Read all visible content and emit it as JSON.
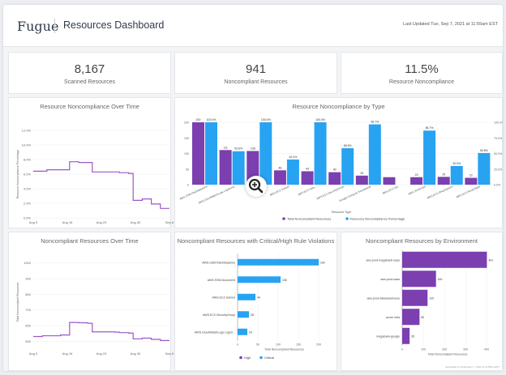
{
  "header": {
    "logo": "Fugue",
    "title": "Resources Dashboard",
    "updated": "Last Updated Tue, Sep 7, 2021 at 11:55am EST"
  },
  "stats": [
    {
      "value": "8,167",
      "label": "Scanned Resources"
    },
    {
      "value": "941",
      "label": "Noncompliant Resources"
    },
    {
      "value": "11.5%",
      "label": "Resource Noncompliance"
    }
  ],
  "colors": {
    "purple": "#7b3fb0",
    "blue": "#27a3f2",
    "line": "#9b59c8"
  },
  "footer": "Generated on September 7, 2021 at 11:55am EST",
  "chart_data": [
    {
      "type": "line",
      "title": "Resource Noncompliance Over Time",
      "ylabel": "Resource Noncompliance Percentage",
      "x_ticks": [
        "Aug 9",
        "Aug 16",
        "Aug 23",
        "Aug 30",
        "Sep 6"
      ],
      "y_ticks": [
        "0.0%",
        "2.0%",
        "4.0%",
        "6.0%",
        "8.0%",
        "10.0%",
        "12.0%"
      ],
      "ylim": [
        0,
        12
      ],
      "x": [
        0,
        1,
        2,
        3,
        4,
        5,
        6,
        7,
        8,
        9,
        10,
        11,
        12,
        13,
        14,
        15,
        16,
        17,
        18,
        19,
        20,
        21,
        22,
        23,
        24,
        25,
        26,
        27,
        28,
        29,
        30
      ],
      "values": [
        6.4,
        6.4,
        6.4,
        6.6,
        6.6,
        6.6,
        6.6,
        6.6,
        7.7,
        7.7,
        7.6,
        7.6,
        7.6,
        6.3,
        6.3,
        6.3,
        6.3,
        6.3,
        6.3,
        6.2,
        6.2,
        6.1,
        2.4,
        2.4,
        2.6,
        2.6,
        1.9,
        1.9,
        1.3,
        1.3,
        1.3
      ]
    },
    {
      "type": "bar",
      "title": "Resource Noncompliance by Type",
      "xlabel": "Resource Type",
      "categories": [
        "AWS.IAM.PatchBaseline",
        "AWS.CloudWatchLogs.LogGroup",
        "AWS.Lambda",
        "AWS.EC2.Subnet",
        "AWS.EC2.Volume",
        "AWS.EC2.SecurityGroup",
        "Google.Compute.Subnetwork",
        "AWS.EC2.Vpc",
        "AWS.S3.Bucket",
        "AWS.EC2.DhcpOptions",
        "AWS.EC2.RouteTable"
      ],
      "x_tick_labels": [
        "AWS.SSM.PatchBaseline",
        "AWS.CloudWatchLogs.LogGroup",
        "AWS",
        "AWS.EC2.Subnet",
        "AWS.EC2.Volu...",
        "AWS.EC2.SecurityGroup",
        "Google.Compute.Subnetwork",
        "AWS.EC2.Vpc",
        "AWS.S3.Bucket",
        "AWS.EC2.DhcpOptions",
        "AWS.EC2.RouteTable"
      ],
      "series": [
        {
          "name": "Total Noncompliant Resources",
          "values": [
            200,
            111,
            108,
            46,
            43,
            40,
            29,
            24,
            24,
            25,
            22
          ],
          "labels": [
            "200",
            "111",
            "108",
            "46",
            "43",
            "40",
            "29",
            "",
            "24",
            "25",
            "22"
          ]
        },
        {
          "name": "Resource Noncompliance Percentage",
          "values": [
            100,
            53.6,
            100,
            40.4,
            100,
            58.5,
            96.7,
            0,
            86.7,
            30,
            50.8
          ],
          "labels": [
            "100.0%",
            "53.6%",
            "",
            "40.4%",
            "100.0%",
            "58.5%",
            "96.7%",
            "",
            "86.7%",
            "30.0%",
            "50.8%"
          ]
        }
      ],
      "extra_labels": [
        "100.0%"
      ],
      "y_ticks": [
        "0",
        "50",
        "100",
        "150",
        "200"
      ],
      "y2_ticks": [
        "0.0%",
        "25.0%",
        "50.0%",
        "75.0%",
        "100.0%"
      ],
      "ylim": [
        0,
        200
      ]
    },
    {
      "type": "line",
      "title": "Noncompliant Resources Over Time",
      "ylabel": "Total Noncompliant Resources",
      "x_ticks": [
        "Aug 9",
        "Aug 16",
        "Aug 23",
        "Aug 30",
        "Sep 6"
      ],
      "y_ticks": [
        "500",
        "600",
        "700",
        "800",
        "900",
        "1000"
      ],
      "ylim": [
        450,
        1050
      ],
      "x": [
        0,
        1,
        2,
        3,
        4,
        5,
        6,
        7,
        8,
        9,
        10,
        11,
        12,
        13,
        14,
        15,
        16,
        17,
        18,
        19,
        20,
        21,
        22,
        23,
        24,
        25,
        26,
        27,
        28,
        29,
        30
      ],
      "values": [
        530,
        530,
        535,
        535,
        535,
        535,
        540,
        540,
        620,
        620,
        618,
        618,
        615,
        560,
        560,
        560,
        560,
        560,
        558,
        555,
        555,
        552,
        515,
        515,
        520,
        520,
        512,
        512,
        505,
        505,
        505
      ]
    },
    {
      "type": "bar",
      "orientation": "horizontal",
      "title": "Noncompliant Resources with Critical/High Rule Violations",
      "xlabel": "Total Noncompliant Resources",
      "categories": [
        "AWS.SSM.PatchBaseline",
        "AWS.SSM.Document",
        "AWS.EC2.Subnet",
        "AWS.EC2.SecurityGroup",
        "AWS.CloudWatchLogs.LogGr..."
      ],
      "series": [
        {
          "name": "High",
          "values": [
            0,
            0,
            0,
            0,
            0
          ]
        },
        {
          "name": "Critical",
          "values": [
            200,
            106,
            44,
            28,
            24
          ]
        }
      ],
      "x_ticks": [
        "0",
        "50",
        "100",
        "150",
        "200"
      ],
      "xlim": [
        0,
        230
      ]
    },
    {
      "type": "bar",
      "orientation": "horizontal",
      "title": "Noncompliant Resources by Environment",
      "xlabel": "Total Noncompliant Resources",
      "categories": [
        "aws-prod-megabank-saas",
        "aws-prod-saas",
        "aws-prod-datawarehouse",
        "azure infra",
        "megabank-google"
      ],
      "values": [
        401,
        160,
        120,
        82,
        35
      ],
      "x_ticks": [
        "0",
        "100",
        "200",
        "300",
        "400"
      ],
      "xlim": [
        0,
        430
      ]
    }
  ]
}
